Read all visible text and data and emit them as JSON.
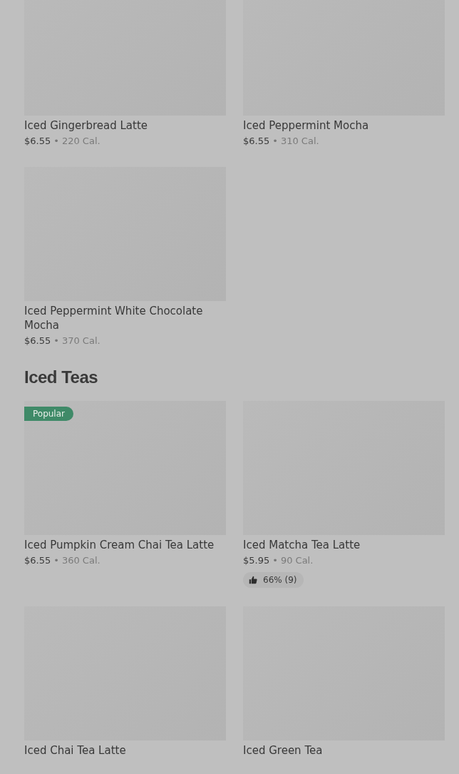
{
  "sections": [
    {
      "items": [
        {
          "name": "Iced Gingerbread Latte",
          "price": "$6.55",
          "separator": "•",
          "calories": "220 Cal."
        },
        {
          "name": "Iced Peppermint Mocha",
          "price": "$6.55",
          "separator": "•",
          "calories": "310 Cal."
        },
        {
          "name": "Iced Peppermint White Chocolate Mocha",
          "price": "$6.55",
          "separator": "•",
          "calories": "370 Cal."
        }
      ]
    },
    {
      "heading": "Iced Teas",
      "items": [
        {
          "name": "Iced Pumpkin Cream Chai Tea Latte",
          "price": "$6.55",
          "separator": "•",
          "calories": "360 Cal.",
          "badge": "Popular"
        },
        {
          "name": "Iced Matcha Tea Latte",
          "price": "$5.95",
          "separator": "•",
          "calories": "90 Cal.",
          "rating": "66% (9)"
        },
        {
          "name": "Iced Chai Tea Latte"
        },
        {
          "name": "Iced Green Tea"
        }
      ]
    }
  ]
}
